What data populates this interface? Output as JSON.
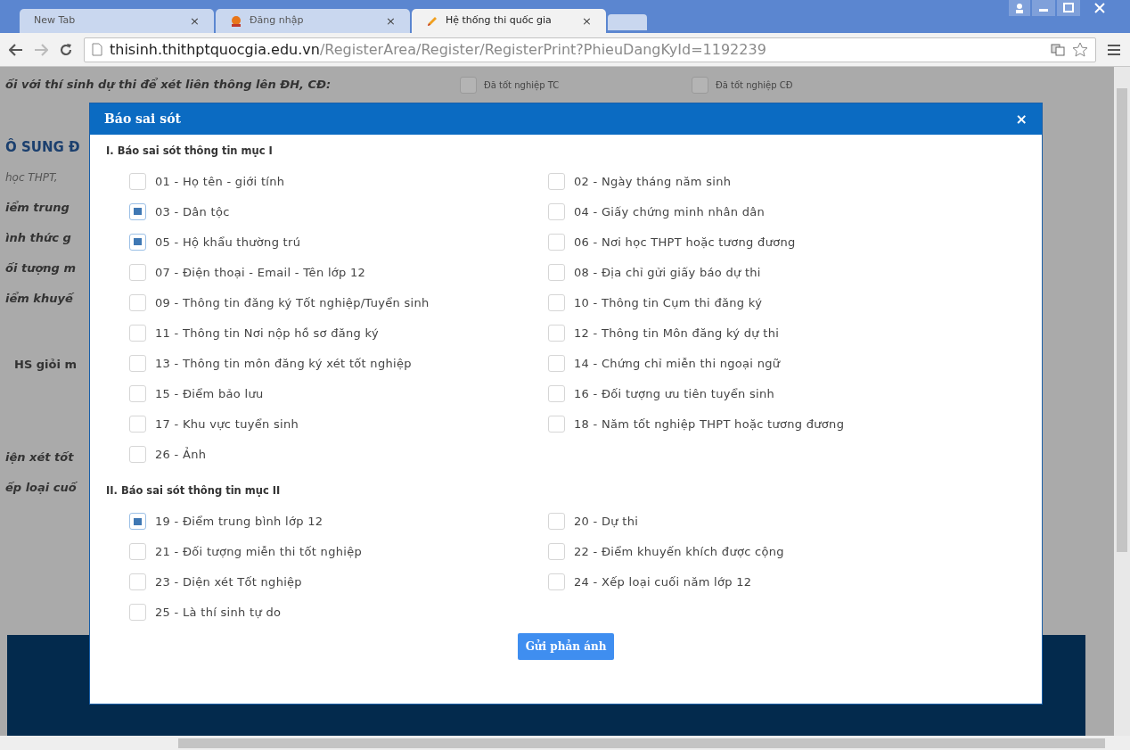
{
  "browser": {
    "tabs": [
      {
        "title": "New Tab",
        "selected": false,
        "kind": "blank"
      },
      {
        "title": "Đăng nhập",
        "selected": false,
        "kind": "site"
      },
      {
        "title": "Hệ thống thi quốc gia",
        "selected": true,
        "kind": "edit"
      }
    ],
    "close_glyph": "×",
    "url": {
      "host": "thisinh.thithptquocgia.edu.vn",
      "path": "/RegisterArea/Register/RegisterPrint?PhieuDangKyId=1192239"
    }
  },
  "page": {
    "top_line": "ối với thí sinh dự thi để xét liên thông lên ĐH, CĐ:",
    "top_options": [
      {
        "label": "Đã tốt nghiệp TC",
        "checked": false
      },
      {
        "label": "Đã tốt nghiệp CĐ",
        "checked": false
      }
    ],
    "fragments": [
      {
        "text": "Ô SUNG Đ",
        "kind": "heading"
      },
      {
        "text": "học THPT,",
        "kind": "note"
      },
      {
        "text": "iểm trung",
        "kind": "field"
      },
      {
        "text": "ình thức g",
        "kind": "field"
      },
      {
        "text": "ối tượng m",
        "kind": "field"
      },
      {
        "text": "iểm khuyế",
        "kind": "field"
      },
      {
        "text": "HS giỏi m",
        "kind": "bold"
      },
      {
        "text": "iện xét tốt",
        "kind": "field"
      },
      {
        "text": "ếp loại cuố",
        "kind": "field"
      }
    ]
  },
  "dialog": {
    "title": "Báo sai sót",
    "close": "×",
    "sections": [
      {
        "title": "I. Báo sai sót thông tin mục I",
        "items": [
          {
            "label": "01 - Họ tên - giới tính",
            "checked": false
          },
          {
            "label": "02 - Ngày tháng năm sinh",
            "checked": false
          },
          {
            "label": "03 - Dân tộc",
            "checked": true
          },
          {
            "label": "04 - Giấy chứng minh nhân dân",
            "checked": false
          },
          {
            "label": "05 - Hộ khẩu thường trú",
            "checked": true
          },
          {
            "label": "06 - Nơi học THPT hoặc tương đương",
            "checked": false
          },
          {
            "label": "07 - Điện thoại - Email - Tên lớp 12",
            "checked": false
          },
          {
            "label": "08 - Địa chỉ gửi giấy báo dự thi",
            "checked": false
          },
          {
            "label": "09 - Thông tin đăng ký Tốt nghiệp/Tuyển sinh",
            "checked": false
          },
          {
            "label": "10 - Thông tin Cụm thi đăng ký",
            "checked": false
          },
          {
            "label": "11 - Thông tin Nơi nộp hồ sơ đăng ký",
            "checked": false
          },
          {
            "label": "12 - Thông tin Môn đăng ký dự thi",
            "checked": false
          },
          {
            "label": "13 - Thông tin môn đăng ký xét tốt nghiệp",
            "checked": false
          },
          {
            "label": "14 - Chứng chỉ miễn thi ngoại ngữ",
            "checked": false
          },
          {
            "label": "15 - Điểm bảo lưu",
            "checked": false
          },
          {
            "label": "16 - Đối tượng ưu tiên tuyển sinh",
            "checked": false
          },
          {
            "label": "17 - Khu vực tuyển sinh",
            "checked": false
          },
          {
            "label": "18 - Năm tốt nghiệp THPT hoặc tương đương",
            "checked": false
          },
          {
            "label": "26 - Ảnh",
            "checked": false
          }
        ]
      },
      {
        "title": "II. Báo sai sót thông tin mục II",
        "items": [
          {
            "label": "19 - Điểm trung bình lớp 12",
            "checked": true
          },
          {
            "label": "20 - Dự thi",
            "checked": false
          },
          {
            "label": "21 - Đối tượng miễn thi tốt nghiệp",
            "checked": false
          },
          {
            "label": "22 - Điểm khuyến khích được cộng",
            "checked": false
          },
          {
            "label": "23 - Diện xét Tốt nghiệp",
            "checked": false
          },
          {
            "label": "24 - Xếp loại cuối năm lớp 12",
            "checked": false
          },
          {
            "label": "25 - Là thí sinh tự do",
            "checked": false
          }
        ]
      }
    ],
    "submit": "Gửi phản ánh"
  }
}
